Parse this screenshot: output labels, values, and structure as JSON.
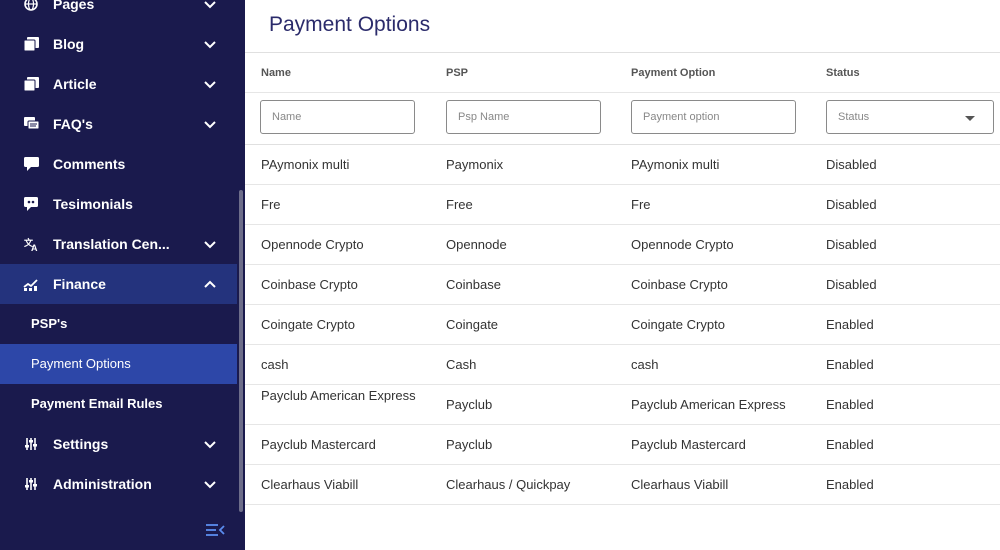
{
  "sidebar": {
    "items": [
      {
        "label": "Pages",
        "icon": "globe-icon",
        "expanded": false
      },
      {
        "label": "Blog",
        "icon": "blog-icon",
        "expanded": false
      },
      {
        "label": "Article",
        "icon": "article-icon",
        "expanded": false
      },
      {
        "label": "FAQ's",
        "icon": "faq-icon",
        "expanded": false
      },
      {
        "label": "Comments",
        "icon": "comments-icon"
      },
      {
        "label": "Tesimonials",
        "icon": "testimonials-icon"
      },
      {
        "label": "Translation Cen...",
        "icon": "translate-icon",
        "expanded": false
      },
      {
        "label": "Finance",
        "icon": "finance-icon",
        "expanded": true
      },
      {
        "label": "Settings",
        "icon": "settings-icon",
        "expanded": false
      },
      {
        "label": "Administration",
        "icon": "administration-icon",
        "expanded": false
      }
    ],
    "finance_sub": [
      {
        "label": "PSP's"
      },
      {
        "label": "Payment Options",
        "selected": true
      },
      {
        "label": "Payment Email Rules"
      }
    ],
    "colors": {
      "bg": "#1a1a4d",
      "active_parent": "#24337d",
      "selected": "#2d47a8"
    }
  },
  "main": {
    "title": "Payment Options",
    "columns": [
      "Name",
      "PSP",
      "Payment Option",
      "Status"
    ],
    "filters": {
      "name_placeholder": "Name",
      "psp_placeholder": "Psp Name",
      "option_placeholder": "Payment option",
      "status_placeholder": "Status"
    },
    "rows": [
      [
        "PAymonix multi",
        "Paymonix",
        "PAymonix multi",
        "Disabled"
      ],
      [
        "Fre",
        "Free",
        "Fre",
        "Disabled"
      ],
      [
        "Opennode Crypto",
        "Opennode",
        "Opennode Crypto",
        "Disabled"
      ],
      [
        "Coinbase Crypto",
        "Coinbase",
        "Coinbase Crypto",
        "Disabled"
      ],
      [
        "Coingate Crypto",
        "Coingate",
        "Coingate Crypto",
        "Enabled"
      ],
      [
        "cash",
        "Cash",
        "cash",
        "Enabled"
      ],
      [
        "Payclub American Express",
        "Payclub",
        "Payclub American Express",
        "Enabled"
      ],
      [
        "Payclub Mastercard",
        "Payclub",
        "Payclub Mastercard",
        "Enabled"
      ],
      [
        "Clearhaus Viabill",
        "Clearhaus / Quickpay",
        "Clearhaus Viabill",
        "Enabled"
      ]
    ]
  }
}
